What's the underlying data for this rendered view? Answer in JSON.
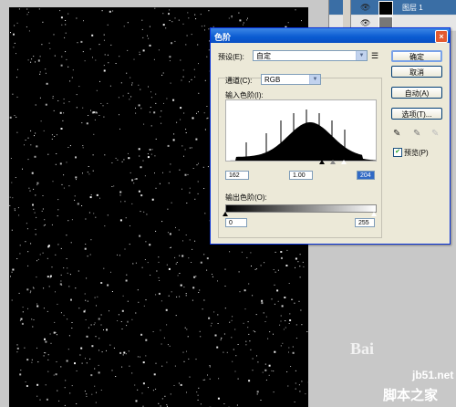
{
  "layers_panel": {
    "layer_name": "图层 1"
  },
  "dialog": {
    "title": "色阶",
    "preset_label": "预设(E):",
    "preset_value": "自定",
    "channel_label": "通道(C):",
    "channel_value": "RGB",
    "input_levels_label": "输入色阶(I):",
    "input_black": "162",
    "input_gamma": "1.00",
    "input_white": "204",
    "output_levels_label": "输出色阶(O):",
    "output_black": "0",
    "output_white": "255",
    "buttons": {
      "ok": "确定",
      "cancel": "取消",
      "auto": "自动(A)",
      "options": "选项(T)..."
    },
    "preview_label": "预览(P)",
    "preview_checked": true
  },
  "watermarks": {
    "site1": "jb51.net",
    "site2": "脚本之家",
    "baidu": "Bai"
  }
}
